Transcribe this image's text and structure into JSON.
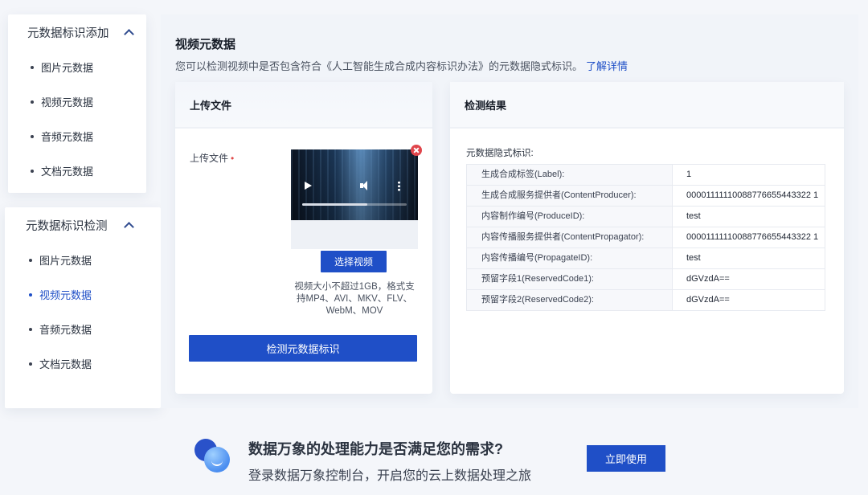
{
  "sidebar": {
    "groups": [
      {
        "title": "元数据标识添加",
        "items": [
          "图片元数据",
          "视频元数据",
          "音频元数据",
          "文档元数据"
        ]
      },
      {
        "title": "元数据标识检测",
        "items": [
          "图片元数据",
          "视频元数据",
          "音频元数据",
          "文档元数据"
        ],
        "active_item": "视频元数据"
      }
    ]
  },
  "page": {
    "title": "视频元数据",
    "description": "您可以检测视频中是否包含符合《人工智能生成合成内容标识办法》的元数据隐式标识。",
    "learn_more": "了解详情"
  },
  "upload": {
    "card_title": "上传文件",
    "field_label": "上传文件",
    "required_mark": "•",
    "player_progress_percent": 62,
    "select_button": "选择视频",
    "hint": "视频大小不超过1GB，格式支持MP4、AVI、MKV、FLV、WebM、MOV",
    "detect_button": "检测元数据标识"
  },
  "result": {
    "card_title": "检测结果",
    "section_label": "元数据隐式标识:",
    "rows": [
      {
        "key": "生成合成标签(Label):",
        "value": "1"
      },
      {
        "key": "生成合成服务提供者(ContentProducer):",
        "value": "00001111110088776655443322 1"
      },
      {
        "key": "内容制作编号(ProduceID):",
        "value": "test"
      },
      {
        "key": "内容传播服务提供者(ContentPropagator):",
        "value": "00001111110088776655443322 1"
      },
      {
        "key": "内容传播编号(PropagateID):",
        "value": "test"
      },
      {
        "key": "预留字段1(ReservedCode1):",
        "value": "dGVzdA=="
      },
      {
        "key": "预留字段2(ReservedCode2):",
        "value": "dGVzdA=="
      }
    ]
  },
  "banner": {
    "title": "数据万象的处理能力是否满足您的需求?",
    "subtitle": "登录数据万象控制台，开启您的云上数据处理之旅",
    "button": "立即使用"
  },
  "colors": {
    "accent": "#1f4fc7",
    "remove": "#e0454b"
  },
  "icons": [
    "chevron-up-icon",
    "play-icon",
    "volume-icon",
    "more-icon",
    "remove-icon",
    "product-logo-icon"
  ]
}
